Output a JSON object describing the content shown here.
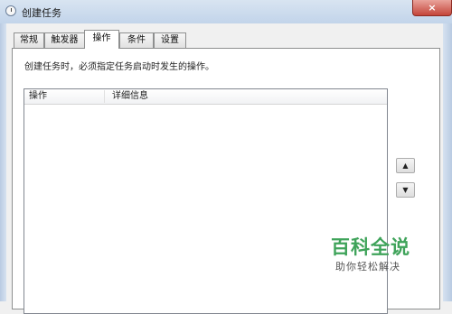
{
  "window": {
    "title": "创建任务",
    "close_glyph": "×"
  },
  "tabs": [
    {
      "label": "常规",
      "active": false
    },
    {
      "label": "触发器",
      "active": false
    },
    {
      "label": "操作",
      "active": true
    },
    {
      "label": "条件",
      "active": false
    },
    {
      "label": "设置",
      "active": false
    }
  ],
  "panel": {
    "description": "创建任务时，必须指定任务启动时发生的操作。",
    "list": {
      "columns": [
        "操作",
        "详细信息"
      ],
      "rows": []
    },
    "buttons": {
      "move_up_glyph": "▲",
      "move_down_glyph": "▼"
    }
  },
  "watermark": {
    "brand": "百科全说",
    "tagline": "助你轻松解决"
  },
  "colors": {
    "accent": "#3fa35a",
    "close": "#c4453a"
  }
}
